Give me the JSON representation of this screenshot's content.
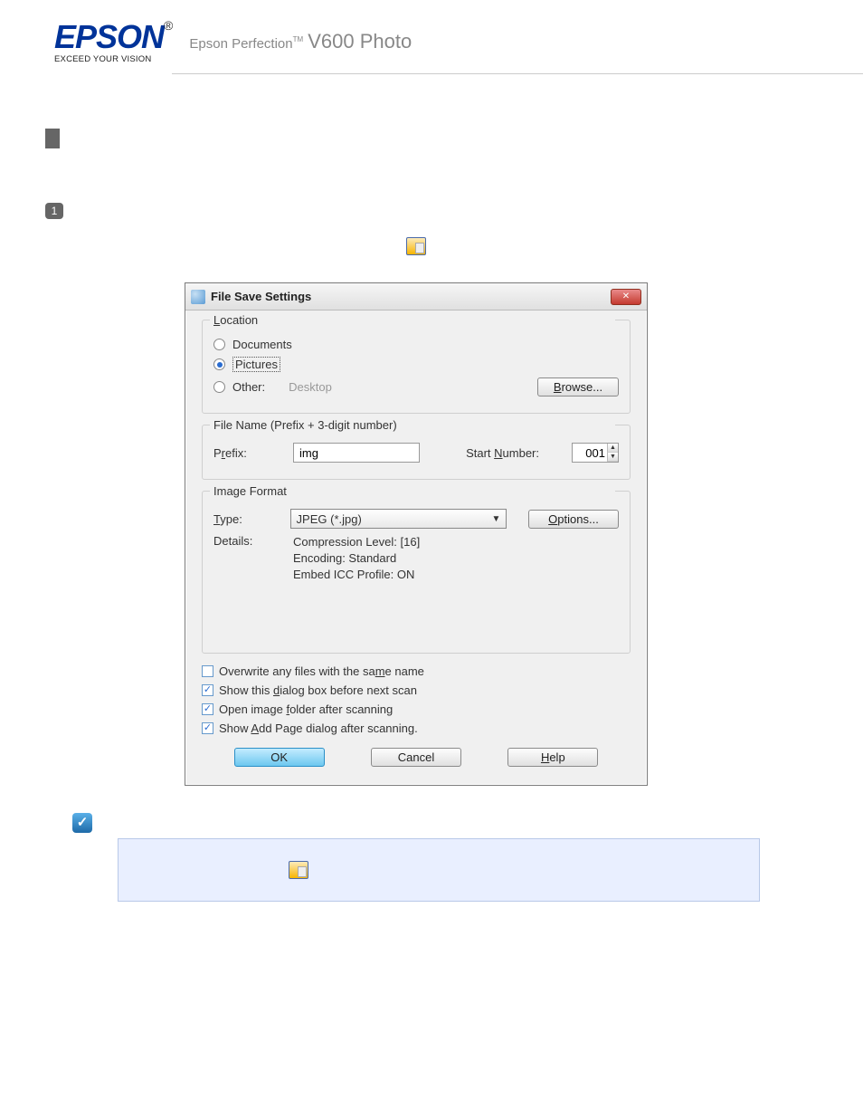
{
  "header": {
    "brand": "EPSON",
    "reg": "®",
    "tagline": "EXCEED YOUR VISION",
    "product_prefix": "Epson Perfection",
    "product_tm": "TM",
    "product_model": "V600 Photo"
  },
  "step_badge": "1",
  "dialog": {
    "title": "File Save Settings",
    "location": {
      "legend": "Location",
      "documents": "Documents",
      "pictures": "Pictures",
      "other_label": "Other:",
      "other_value": "Desktop",
      "browse": "Browse...",
      "selected": "pictures"
    },
    "filename": {
      "legend": "File Name (Prefix + 3-digit number)",
      "prefix_label": "Prefix:",
      "prefix_value": "img",
      "start_label": "Start Number:",
      "start_value": "001"
    },
    "format": {
      "legend": "Image Format",
      "type_label": "Type:",
      "type_value": "JPEG (*.jpg)",
      "options_btn": "Options...",
      "details_label": "Details:",
      "detail1": "Compression Level: [16]",
      "detail2": "Encoding: Standard",
      "detail3": "Embed ICC Profile: ON"
    },
    "checks": {
      "overwrite": "Overwrite any files with the same name",
      "showdialog": "Show this dialog box before next scan",
      "openfolder": "Open image folder after scanning",
      "addpage": "Show Add Page dialog after scanning."
    },
    "actions": {
      "ok": "OK",
      "cancel": "Cancel",
      "help": "Help"
    }
  },
  "note": {
    "check": "✓"
  }
}
